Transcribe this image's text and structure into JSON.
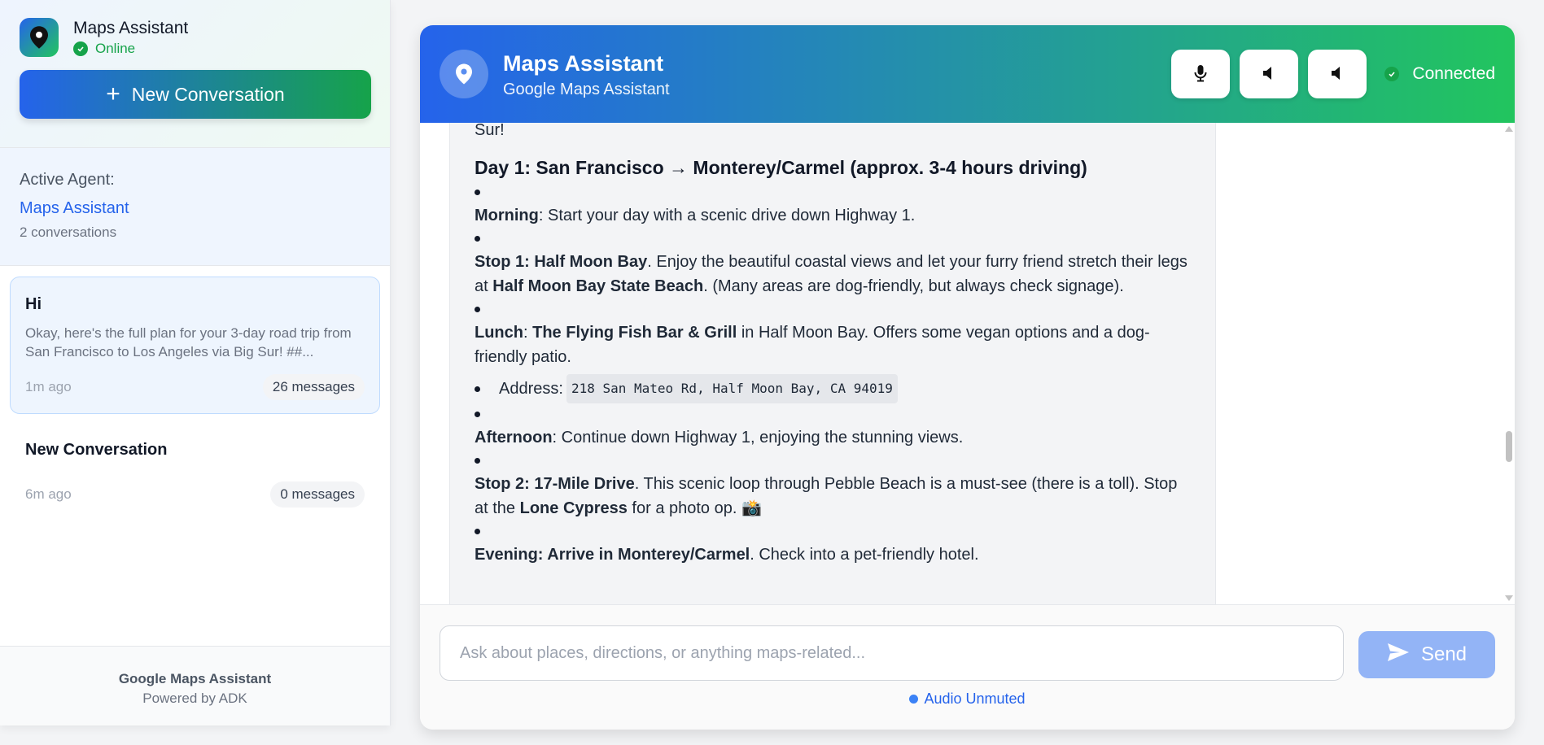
{
  "sidebar": {
    "app_name": "Maps Assistant",
    "status": "Online",
    "new_conversation_label": "New Conversation",
    "active_agent_label": "Active Agent:",
    "active_agent_name": "Maps Assistant",
    "conversation_count": "2 conversations",
    "conversations": [
      {
        "title": "Hi",
        "preview": "Okay, here's the full plan for your 3-day road trip from San Francisco to Los Angeles via Big Sur! ##...",
        "time": "1m ago",
        "messages": "26 messages"
      },
      {
        "title": "New Conversation",
        "preview": "",
        "time": "6m ago",
        "messages": "0 messages"
      }
    ],
    "footer_title": "Google Maps Assistant",
    "footer_sub": "Powered by ADK"
  },
  "header": {
    "title": "Maps Assistant",
    "subtitle": "Google Maps Assistant",
    "connection_status": "Connected"
  },
  "message": {
    "top_fragment": "Sur!",
    "day_heading": "Day 1: San Francisco → Monterey/Carmel (approx. 3-4 hours driving)",
    "morning_label": "Morning",
    "morning_text": ": Start your day with a scenic drive down Highway 1.",
    "stop1_label": "Stop 1: Half Moon Bay",
    "stop1_text": ". Enjoy the beautiful coastal views and let your furry friend stretch their legs at ",
    "stop1_beach": "Half Moon Bay State Beach",
    "stop1_tail": ". (Many areas are dog-friendly, but always check signage).",
    "lunch_label": "Lunch",
    "lunch_sep": ": ",
    "lunch_place": "The Flying Fish Bar & Grill",
    "lunch_text": " in Half Moon Bay. Offers some vegan options and a dog-friendly patio.",
    "address_label": "Address:",
    "address_value": "218 San Mateo Rd, Half Moon Bay, CA 94019",
    "afternoon_label": "Afternoon",
    "afternoon_text": ": Continue down Highway 1, enjoying the stunning views.",
    "stop2_label": "Stop 2: 17-Mile Drive",
    "stop2_text": ". This scenic loop through Pebble Beach is a must-see (there is a toll). Stop at the ",
    "stop2_place": "Lone Cypress",
    "stop2_tail": " for a photo op. 📸",
    "evening_label": "Evening: Arrive in Monterey/Carmel",
    "evening_text": ". Check into a pet-friendly hotel."
  },
  "composer": {
    "placeholder": "Ask about places, directions, or anything maps-related...",
    "value": "",
    "send_label": "Send",
    "audio_status": "Audio Unmuted"
  },
  "colors": {
    "primary_blue": "#2563eb",
    "primary_green": "#22c55e",
    "online_green": "#16a34a"
  },
  "icons": {
    "brand": "map-pin-icon",
    "mic": "microphone-icon",
    "speaker": "speaker-icon",
    "send": "paper-plane-icon"
  }
}
